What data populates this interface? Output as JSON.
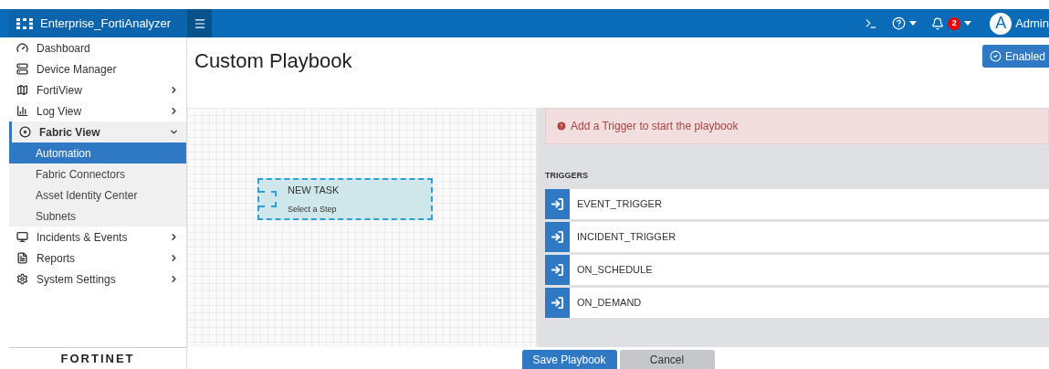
{
  "header": {
    "app_name": "Enterprise_FortiAnalyzer",
    "notification_count": "2",
    "user": {
      "initial": "A",
      "name": "Admin"
    }
  },
  "sidebar": {
    "items": [
      {
        "label": "Dashboard",
        "kind": "link"
      },
      {
        "label": "Device Manager",
        "kind": "link"
      },
      {
        "label": "FortiView",
        "kind": "group",
        "expanded": false
      },
      {
        "label": "Log View",
        "kind": "group",
        "expanded": false
      },
      {
        "label": "Fabric View",
        "kind": "group",
        "expanded": true,
        "children": [
          {
            "label": "Automation",
            "selected": true
          },
          {
            "label": "Fabric Connectors",
            "selected": false
          },
          {
            "label": "Asset Identity Center",
            "selected": false
          },
          {
            "label": "Subnets",
            "selected": false
          }
        ]
      },
      {
        "label": "Incidents & Events",
        "kind": "group",
        "expanded": false
      },
      {
        "label": "Reports",
        "kind": "group",
        "expanded": false
      },
      {
        "label": "System Settings",
        "kind": "group",
        "expanded": false
      }
    ],
    "logo": "FORTINET"
  },
  "page": {
    "title": "Custom Playbook",
    "status_button": {
      "label": "Enabled",
      "on": true
    }
  },
  "canvas": {
    "node": {
      "title": "NEW TASK",
      "subtitle": "Select a Step"
    }
  },
  "panel": {
    "alert": "Add a Trigger to start the playbook",
    "section_title": "TRIGGERS",
    "triggers": [
      {
        "label": "EVENT_TRIGGER"
      },
      {
        "label": "INCIDENT_TRIGGER"
      },
      {
        "label": "ON_SCHEDULE"
      },
      {
        "label": "ON_DEMAND"
      }
    ]
  },
  "buttons": [
    {
      "label": "Save Playbook",
      "kind": "primary"
    },
    {
      "label": "Cancel",
      "kind": "secondary"
    }
  ]
}
